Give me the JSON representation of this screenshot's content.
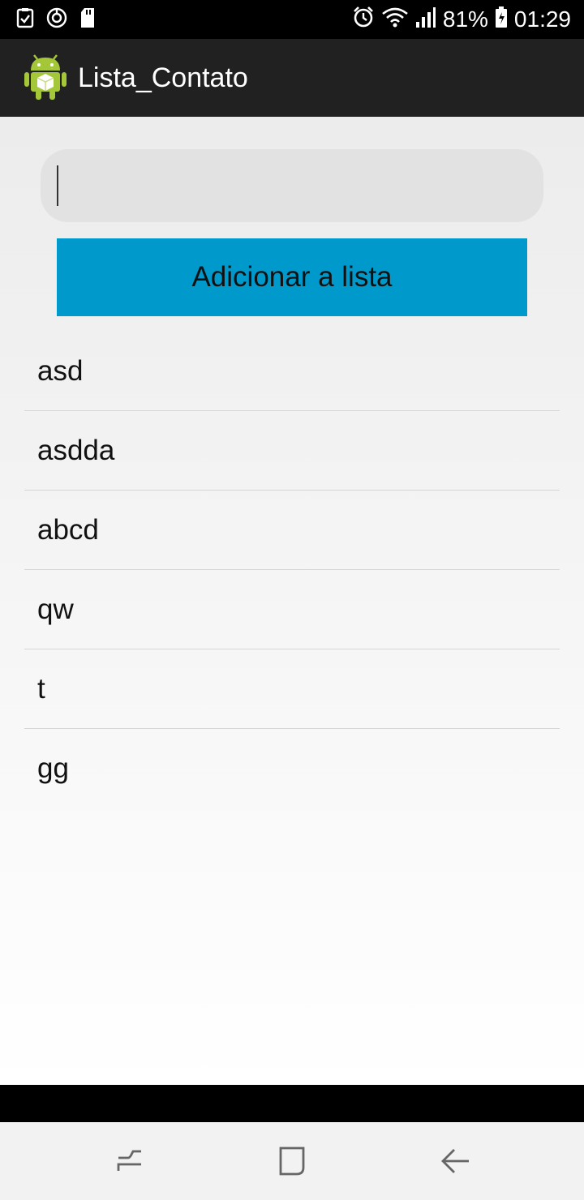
{
  "status_bar": {
    "battery_percent": "81%",
    "time": "01:29",
    "left_icons": [
      "checklist-icon",
      "sync-icon",
      "sd-card-icon"
    ],
    "right_icons": [
      "alarm-icon",
      "wifi-icon",
      "signal-icon",
      "battery-icon"
    ]
  },
  "action_bar": {
    "title": "Lista_Contato",
    "icon": "android-app-icon"
  },
  "form": {
    "input_value": "",
    "add_button_label": "Adicionar a lista"
  },
  "list": {
    "items": [
      "asd",
      "asdda",
      "abcd",
      "qw",
      "t",
      "gg"
    ]
  },
  "nav_bar": {
    "buttons": [
      "recent-apps-icon",
      "home-icon",
      "back-icon"
    ]
  },
  "colors": {
    "button": "#0099cc",
    "action_bar": "#212121",
    "android_green": "#a4c639"
  }
}
